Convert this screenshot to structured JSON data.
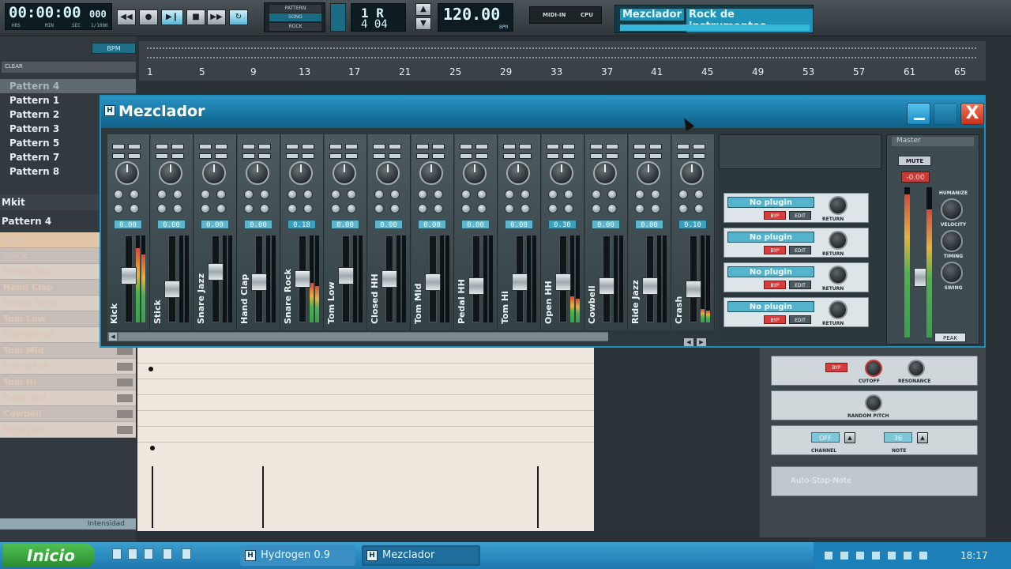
{
  "transport": {
    "time": "00:00:00",
    "time_frac": "000",
    "time_units": [
      "HRS",
      "MIN",
      "SEC",
      "1/1000"
    ],
    "mode_pattern": "PATTERN",
    "mode_song": "SONG",
    "mode_rock": "ROCK",
    "bars_top": "1 R",
    "bars_bottom": "4 04",
    "tempo": "120.00",
    "tempo_unit": "BPM",
    "midi_in": "MIDI-IN",
    "cpu": "CPU",
    "window_label": "Mezclador",
    "song_name": "Rock de instrumentos"
  },
  "left_panel": {
    "bpm_button": "BPM",
    "clear_button": "CLEAR",
    "patterns_header": "Pattern 4",
    "patterns": [
      "Pattern 1",
      "Pattern 2",
      "Pattern 3",
      "Pattern 5",
      "Pattern 7",
      "Pattern 8"
    ],
    "kit_label": "Mkit",
    "current_pattern": "Pattern 4",
    "instruments": [
      "Kick",
      "Stick",
      "Snare Jazz",
      "Hand Clap",
      "Snare Rock",
      "Tom Low",
      "Closed HH",
      "Tom Mid",
      "Pedal HH",
      "Tom Hi",
      "Open HH",
      "Cowbell",
      "Ride Jazz"
    ],
    "intensity_label": "Intensidad"
  },
  "ruler": {
    "ticks": [
      "1",
      "5",
      "9",
      "13",
      "17",
      "21",
      "25",
      "29",
      "33",
      "37",
      "41",
      "45",
      "49",
      "53",
      "57",
      "61",
      "65"
    ]
  },
  "mixer": {
    "title": "Mezclador",
    "close_symbol": "X",
    "app_icon": "H",
    "channels": [
      {
        "name": "Kick",
        "value": "0.00",
        "fader": 0.55,
        "meter": 0.85
      },
      {
        "name": "Stick",
        "value": "0.00",
        "fader": 0.35,
        "meter": 0.0
      },
      {
        "name": "Snare Jazz",
        "value": "0.00",
        "fader": 0.6,
        "meter": 0.0
      },
      {
        "name": "Hand Clap",
        "value": "0.00",
        "fader": 0.45,
        "meter": 0.0
      },
      {
        "name": "Snare Rock",
        "value": "0.18",
        "fader": 0.5,
        "meter": 0.45
      },
      {
        "name": "Tom Low",
        "value": "0.00",
        "fader": 0.55,
        "meter": 0.0
      },
      {
        "name": "Closed HH",
        "value": "0.00",
        "fader": 0.5,
        "meter": 0.0
      },
      {
        "name": "Tom Mid",
        "value": "0.00",
        "fader": 0.45,
        "meter": 0.0
      },
      {
        "name": "Pedal HH",
        "value": "0.00",
        "fader": 0.4,
        "meter": 0.0
      },
      {
        "name": "Tom Hi",
        "value": "0.00",
        "fader": 0.45,
        "meter": 0.0
      },
      {
        "name": "Open HH",
        "value": "0.30",
        "fader": 0.45,
        "meter": 0.3
      },
      {
        "name": "Cowbell",
        "value": "0.00",
        "fader": 0.4,
        "meter": 0.0
      },
      {
        "name": "Ride Jazz",
        "value": "0.00",
        "fader": 0.4,
        "meter": 0.0
      },
      {
        "name": "Crash",
        "value": "0.10",
        "fader": 0.35,
        "meter": 0.15
      }
    ],
    "fx_slots": [
      {
        "name": "No plugin",
        "bypass": "BYP",
        "edit": "EDIT",
        "return": "RETURN"
      },
      {
        "name": "No plugin",
        "bypass": "BYP",
        "edit": "EDIT",
        "return": "RETURN"
      },
      {
        "name": "No plugin",
        "bypass": "BYP",
        "edit": "EDIT",
        "return": "RETURN"
      },
      {
        "name": "No plugin",
        "bypass": "BYP",
        "edit": "EDIT",
        "return": "RETURN"
      }
    ],
    "master": {
      "title": "Master",
      "mute": "MUTE",
      "level": "-0.00",
      "humanize": "HUMANIZE",
      "velocity": "VELOCITY",
      "timing": "TIMING",
      "swing": "SWING",
      "peak": "PEAK",
      "meter_left": 0.95,
      "meter_right": 0.85
    }
  },
  "instrument_panel": {
    "byp": "BYP",
    "cutoff": "CUTOFF",
    "resonance": "RESONANCE",
    "random_pitch": "RANDOM PITCH",
    "channel_value": "OFF",
    "channel_label": "CHANNEL",
    "note_value": "36",
    "note_label": "NOTE",
    "fx_checkbox": "Auto-Stop-Note"
  },
  "taskbar": {
    "start": "Inicio",
    "task1": "Hydrogen 0.9",
    "task2": "Mezclador",
    "clock": "18:17"
  }
}
